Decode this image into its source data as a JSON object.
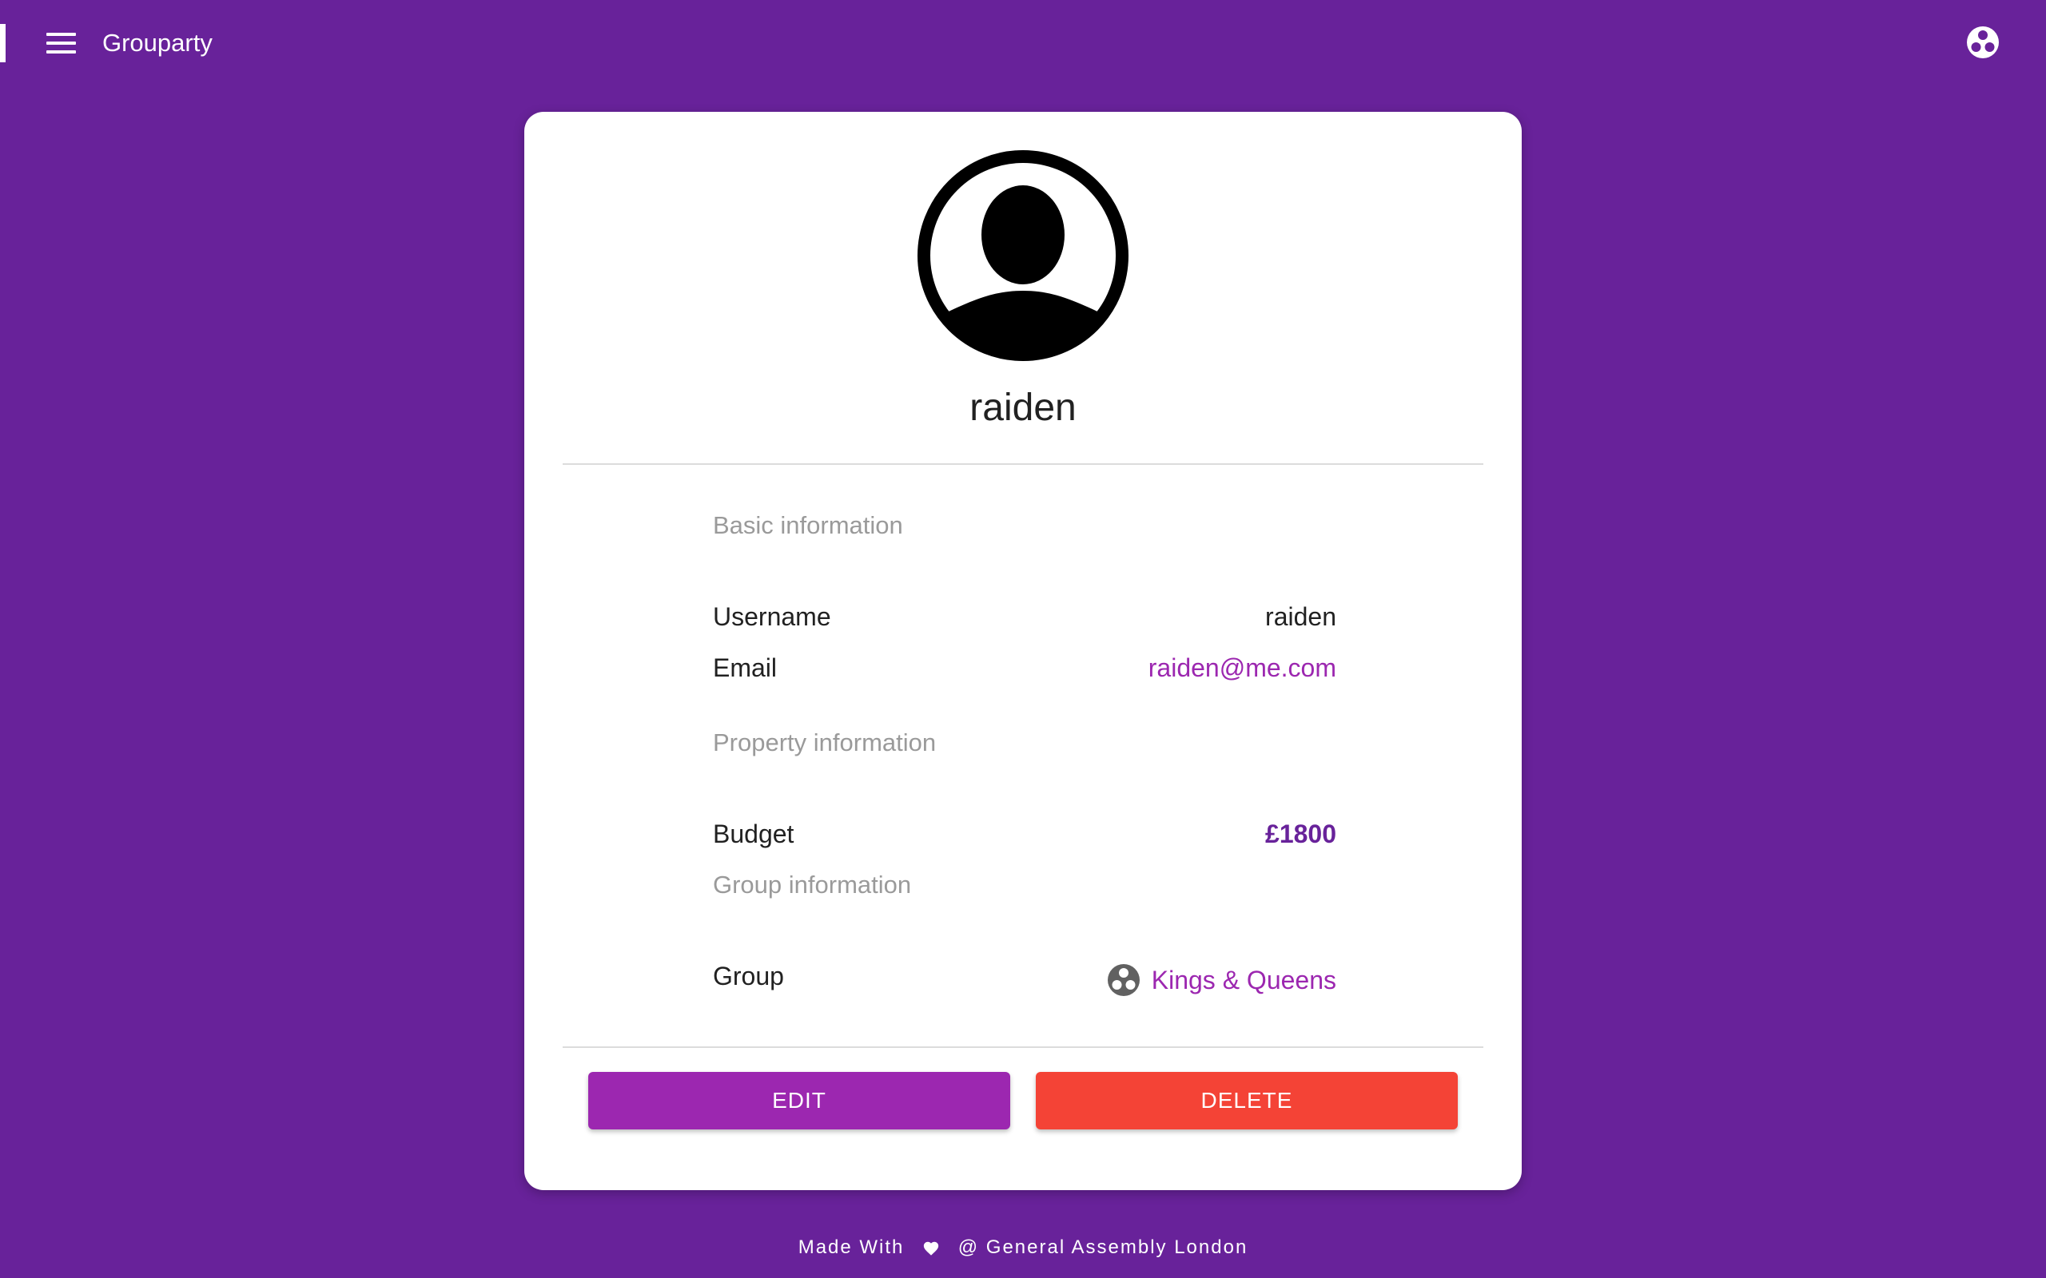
{
  "app": {
    "title": "Grouparty"
  },
  "topbar": {
    "menu_icon": "hamburger-menu-icon",
    "logo_icon": "three-dots-circle-logo-icon"
  },
  "profile": {
    "avatar_icon": "account-circle-icon",
    "name": "raiden"
  },
  "basic_info": {
    "heading": "Basic information",
    "username_label": "Username",
    "username_value": "raiden",
    "email_label": "Email",
    "email_value": "raiden@me.com"
  },
  "property_info": {
    "heading": "Property information",
    "budget_label": "Budget",
    "budget_value": "£1800"
  },
  "group_info": {
    "heading": "Group information",
    "group_label": "Group",
    "group_icon": "group-logo-icon",
    "group_value": "Kings & Queens"
  },
  "actions": {
    "edit_label": "EDIT",
    "delete_label": "DELETE"
  },
  "footer": {
    "made_with": "Made With",
    "heart_icon": "heart-icon",
    "credit": "@ General Assembly London"
  },
  "colors": {
    "background": "#68229a",
    "accent": "#9c27b0",
    "danger": "#f44336",
    "card": "#ffffff"
  }
}
